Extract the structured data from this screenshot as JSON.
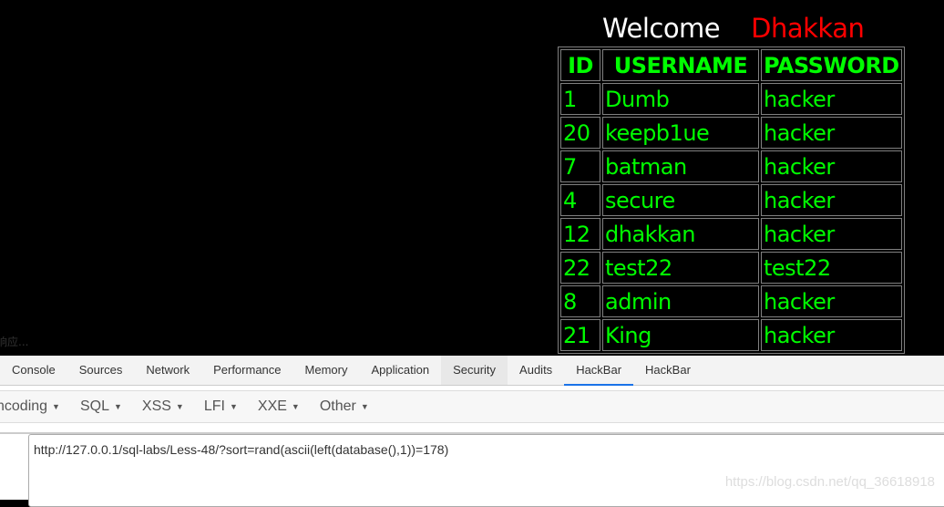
{
  "page": {
    "welcome_label": "Welcome",
    "user_name": "Dhakkan",
    "table": {
      "headers": [
        "ID",
        "USERNAME",
        "PASSWORD"
      ],
      "rows": [
        [
          "1",
          "Dumb",
          "hacker"
        ],
        [
          "20",
          "keepb1ue",
          "hacker"
        ],
        [
          "7",
          "batman",
          "hacker"
        ],
        [
          "4",
          "secure",
          "hacker"
        ],
        [
          "12",
          "dhakkan",
          "hacker"
        ],
        [
          "22",
          "test22",
          "test22"
        ],
        [
          "8",
          "admin",
          "hacker"
        ],
        [
          "21",
          "King",
          "hacker"
        ]
      ]
    },
    "status_text": "响应..."
  },
  "devtools": {
    "tabs": [
      "Console",
      "Sources",
      "Network",
      "Performance",
      "Memory",
      "Application",
      "Security",
      "Audits",
      "HackBar",
      "HackBar"
    ],
    "active_tab": "HackBar",
    "hackbar": {
      "menus": [
        "ncoding",
        "SQL",
        "XSS",
        "LFI",
        "XXE",
        "Other"
      ],
      "url_value": "http://127.0.0.1/sql-labs/Less-48/?sort=rand(ascii(left(database(),1))=178)"
    }
  },
  "watermark": "https://blog.csdn.net/qq_36618918",
  "colors": {
    "text_green": "#00ff00",
    "name_red": "#ff0000",
    "tab_accent": "#1a73e8"
  }
}
